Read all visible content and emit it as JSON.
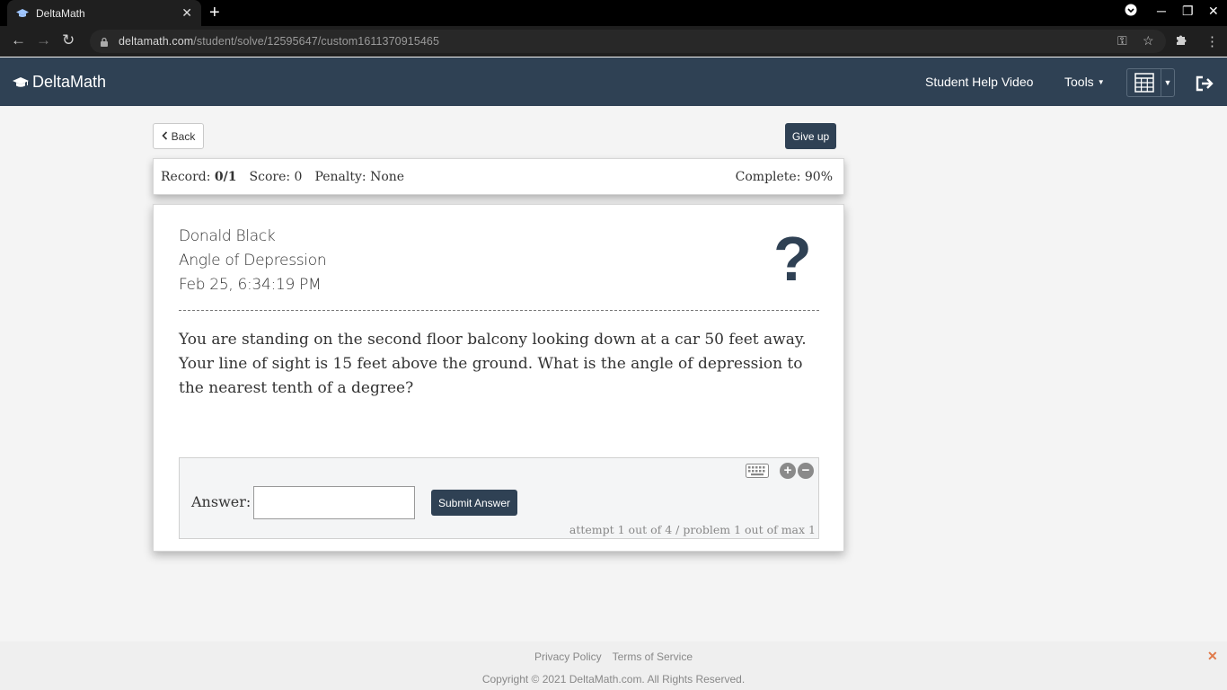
{
  "browser": {
    "tab_title": "DeltaMath",
    "url_host": "deltamath.com",
    "url_path": "/student/solve/12595647/custom1611370915465"
  },
  "header": {
    "brand": "DeltaMath",
    "help_link": "Student Help Video",
    "tools_label": "Tools"
  },
  "actions": {
    "back_label": "Back",
    "giveup_label": "Give up"
  },
  "record": {
    "record_label": "Record:",
    "record_value": "0/1",
    "score": "Score: 0",
    "penalty": "Penalty: None",
    "complete": "Complete: 90%"
  },
  "problem": {
    "student_name": "Donald Black",
    "topic": "Angle of Depression",
    "timestamp": "Feb 25, 6:34:19 PM",
    "text": "You are standing on the second floor balcony looking down at a car 50 feet away. Your line of sight is 15 feet above the ground. What is the angle of depression to the nearest tenth of a degree?"
  },
  "answer": {
    "label": "Answer:",
    "value": "",
    "submit_label": "Submit Answer",
    "attempt_text": "attempt 1 out of 4 / problem 1 out of max 1"
  },
  "footer": {
    "privacy": "Privacy Policy",
    "terms": "Terms of Service",
    "copyright": "Copyright © 2021 DeltaMath.com. All Rights Reserved."
  },
  "colors": {
    "header_bg": "#2f4154",
    "page_bg": "#f4f4f4",
    "accent_orange": "#e07a4a"
  }
}
